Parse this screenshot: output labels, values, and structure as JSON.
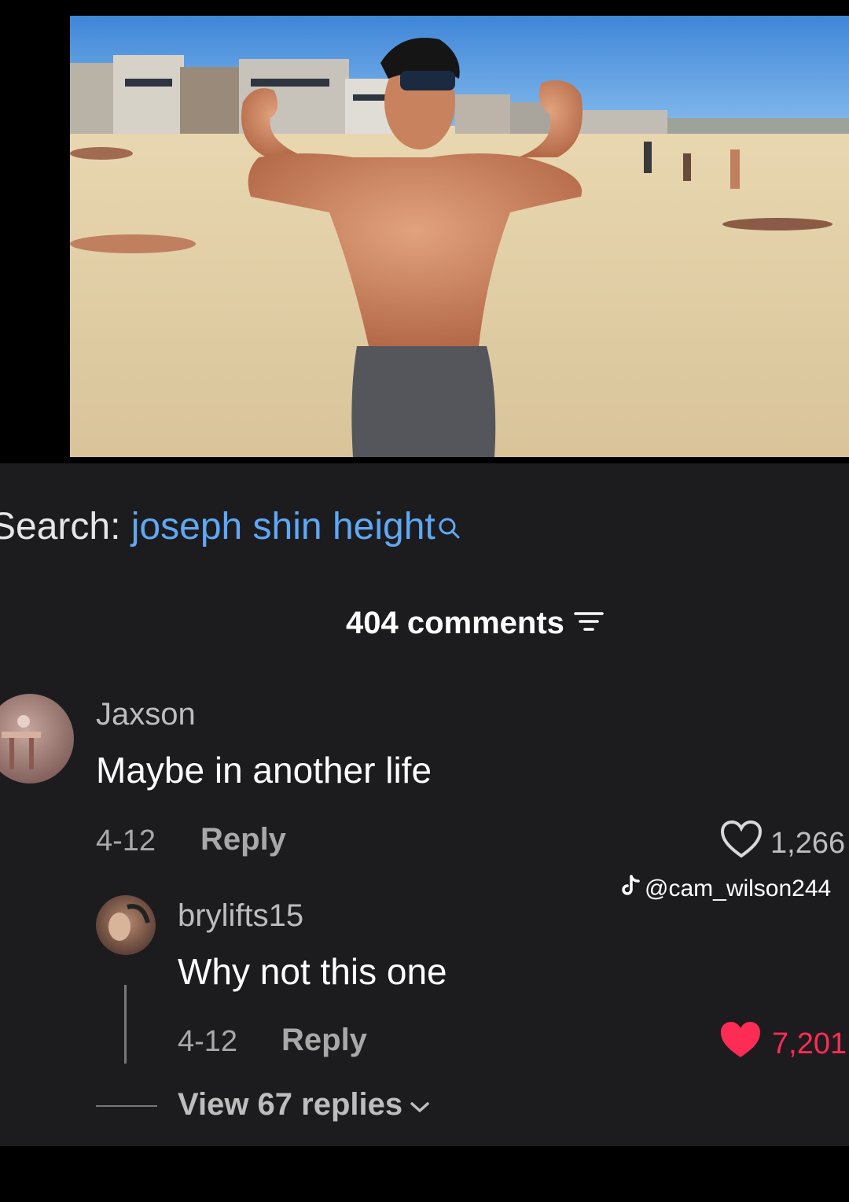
{
  "search": {
    "label": "Search:",
    "query": "joseph shin height",
    "icon": "search-icon"
  },
  "comments_header": {
    "count_text": "404 comments",
    "sort_icon": "filter-icon"
  },
  "comments": [
    {
      "username": "Jaxson",
      "text": "Maybe in another life",
      "date": "4-12",
      "reply_label": "Reply",
      "likes": "1,266",
      "liked": false
    },
    {
      "username": "brylifts15",
      "text": "Why not this one",
      "date": "4-12",
      "reply_label": "Reply",
      "likes": "7,201",
      "liked": true
    }
  ],
  "watermark": {
    "handle": "@cam_wilson244"
  },
  "view_replies": {
    "label": "View 67 replies"
  },
  "colors": {
    "link": "#5fa8f5",
    "liked": "#fe2c55",
    "panel": "#1c1c1e"
  }
}
